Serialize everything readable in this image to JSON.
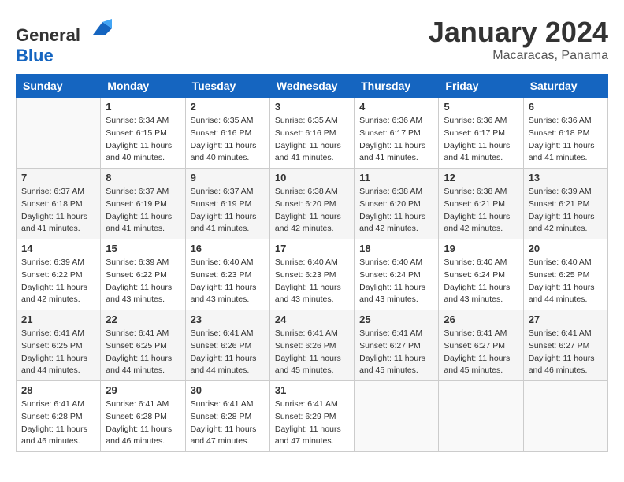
{
  "logo": {
    "text_general": "General",
    "text_blue": "Blue"
  },
  "header": {
    "month": "January 2024",
    "location": "Macaracas, Panama"
  },
  "weekdays": [
    "Sunday",
    "Monday",
    "Tuesday",
    "Wednesday",
    "Thursday",
    "Friday",
    "Saturday"
  ],
  "weeks": [
    [
      {
        "day": null
      },
      {
        "day": "1",
        "sunrise": "6:34 AM",
        "sunset": "6:15 PM",
        "daylight": "11 hours and 40 minutes."
      },
      {
        "day": "2",
        "sunrise": "6:35 AM",
        "sunset": "6:16 PM",
        "daylight": "11 hours and 40 minutes."
      },
      {
        "day": "3",
        "sunrise": "6:35 AM",
        "sunset": "6:16 PM",
        "daylight": "11 hours and 41 minutes."
      },
      {
        "day": "4",
        "sunrise": "6:36 AM",
        "sunset": "6:17 PM",
        "daylight": "11 hours and 41 minutes."
      },
      {
        "day": "5",
        "sunrise": "6:36 AM",
        "sunset": "6:17 PM",
        "daylight": "11 hours and 41 minutes."
      },
      {
        "day": "6",
        "sunrise": "6:36 AM",
        "sunset": "6:18 PM",
        "daylight": "11 hours and 41 minutes."
      }
    ],
    [
      {
        "day": "7",
        "sunrise": "6:37 AM",
        "sunset": "6:18 PM",
        "daylight": "11 hours and 41 minutes."
      },
      {
        "day": "8",
        "sunrise": "6:37 AM",
        "sunset": "6:19 PM",
        "daylight": "11 hours and 41 minutes."
      },
      {
        "day": "9",
        "sunrise": "6:37 AM",
        "sunset": "6:19 PM",
        "daylight": "11 hours and 41 minutes."
      },
      {
        "day": "10",
        "sunrise": "6:38 AM",
        "sunset": "6:20 PM",
        "daylight": "11 hours and 42 minutes."
      },
      {
        "day": "11",
        "sunrise": "6:38 AM",
        "sunset": "6:20 PM",
        "daylight": "11 hours and 42 minutes."
      },
      {
        "day": "12",
        "sunrise": "6:38 AM",
        "sunset": "6:21 PM",
        "daylight": "11 hours and 42 minutes."
      },
      {
        "day": "13",
        "sunrise": "6:39 AM",
        "sunset": "6:21 PM",
        "daylight": "11 hours and 42 minutes."
      }
    ],
    [
      {
        "day": "14",
        "sunrise": "6:39 AM",
        "sunset": "6:22 PM",
        "daylight": "11 hours and 42 minutes."
      },
      {
        "day": "15",
        "sunrise": "6:39 AM",
        "sunset": "6:22 PM",
        "daylight": "11 hours and 43 minutes."
      },
      {
        "day": "16",
        "sunrise": "6:40 AM",
        "sunset": "6:23 PM",
        "daylight": "11 hours and 43 minutes."
      },
      {
        "day": "17",
        "sunrise": "6:40 AM",
        "sunset": "6:23 PM",
        "daylight": "11 hours and 43 minutes."
      },
      {
        "day": "18",
        "sunrise": "6:40 AM",
        "sunset": "6:24 PM",
        "daylight": "11 hours and 43 minutes."
      },
      {
        "day": "19",
        "sunrise": "6:40 AM",
        "sunset": "6:24 PM",
        "daylight": "11 hours and 43 minutes."
      },
      {
        "day": "20",
        "sunrise": "6:40 AM",
        "sunset": "6:25 PM",
        "daylight": "11 hours and 44 minutes."
      }
    ],
    [
      {
        "day": "21",
        "sunrise": "6:41 AM",
        "sunset": "6:25 PM",
        "daylight": "11 hours and 44 minutes."
      },
      {
        "day": "22",
        "sunrise": "6:41 AM",
        "sunset": "6:25 PM",
        "daylight": "11 hours and 44 minutes."
      },
      {
        "day": "23",
        "sunrise": "6:41 AM",
        "sunset": "6:26 PM",
        "daylight": "11 hours and 44 minutes."
      },
      {
        "day": "24",
        "sunrise": "6:41 AM",
        "sunset": "6:26 PM",
        "daylight": "11 hours and 45 minutes."
      },
      {
        "day": "25",
        "sunrise": "6:41 AM",
        "sunset": "6:27 PM",
        "daylight": "11 hours and 45 minutes."
      },
      {
        "day": "26",
        "sunrise": "6:41 AM",
        "sunset": "6:27 PM",
        "daylight": "11 hours and 45 minutes."
      },
      {
        "day": "27",
        "sunrise": "6:41 AM",
        "sunset": "6:27 PM",
        "daylight": "11 hours and 46 minutes."
      }
    ],
    [
      {
        "day": "28",
        "sunrise": "6:41 AM",
        "sunset": "6:28 PM",
        "daylight": "11 hours and 46 minutes."
      },
      {
        "day": "29",
        "sunrise": "6:41 AM",
        "sunset": "6:28 PM",
        "daylight": "11 hours and 46 minutes."
      },
      {
        "day": "30",
        "sunrise": "6:41 AM",
        "sunset": "6:28 PM",
        "daylight": "11 hours and 47 minutes."
      },
      {
        "day": "31",
        "sunrise": "6:41 AM",
        "sunset": "6:29 PM",
        "daylight": "11 hours and 47 minutes."
      },
      {
        "day": null
      },
      {
        "day": null
      },
      {
        "day": null
      }
    ]
  ]
}
